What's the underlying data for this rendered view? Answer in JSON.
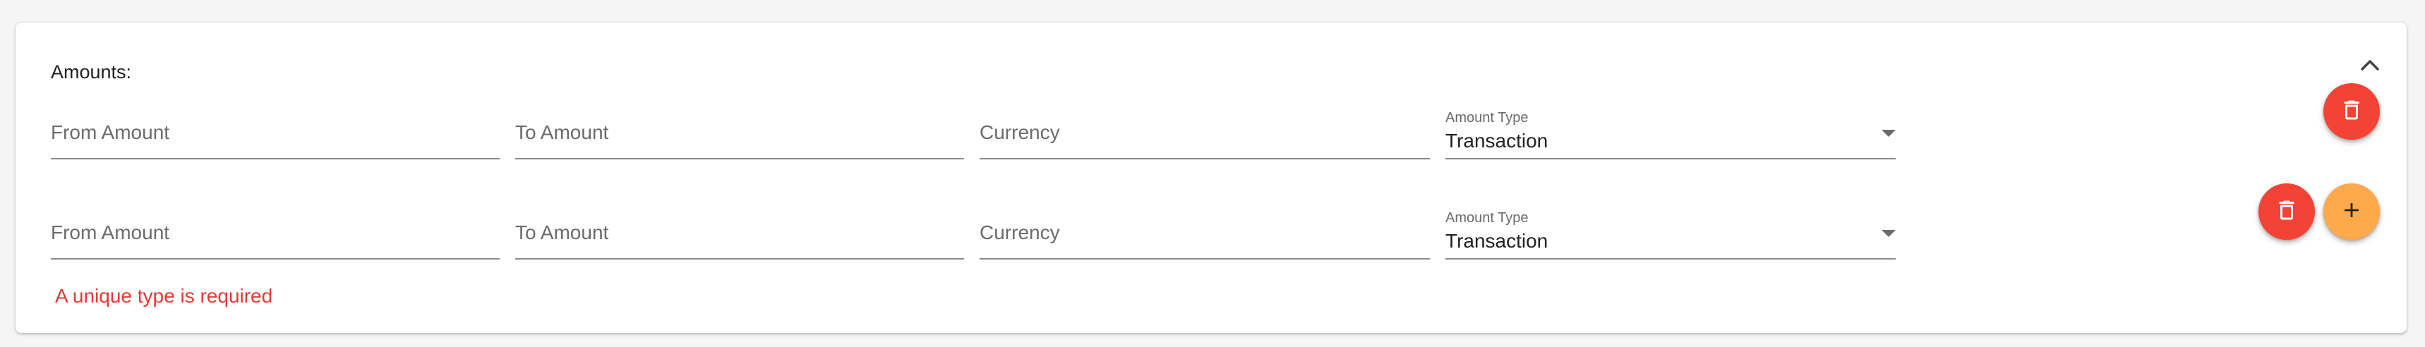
{
  "section": {
    "title": "Amounts:",
    "collapse_icon": "chevron-up-icon"
  },
  "rows": [
    {
      "from_amount_placeholder": "From Amount",
      "to_amount_placeholder": "To Amount",
      "currency_placeholder": "Currency",
      "amount_type_label": "Amount Type",
      "amount_type_value": "Transaction",
      "actions": [
        "delete"
      ]
    },
    {
      "from_amount_placeholder": "From Amount",
      "to_amount_placeholder": "To Amount",
      "currency_placeholder": "Currency",
      "amount_type_label": "Amount Type",
      "amount_type_value": "Transaction",
      "actions": [
        "delete",
        "add"
      ]
    }
  ],
  "validation": {
    "error": "A unique type is required"
  },
  "colors": {
    "delete_button": "#f44336",
    "add_button": "#ffa94d",
    "error_text": "#e53935"
  }
}
